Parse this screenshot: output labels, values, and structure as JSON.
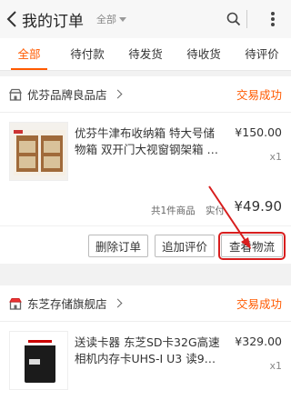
{
  "header": {
    "title": "我的订单",
    "scope": "全部"
  },
  "tabs": [
    "全部",
    "待付款",
    "待发货",
    "待收货",
    "待评价"
  ],
  "orders": [
    {
      "shop": "优芬品牌良品店",
      "status": "交易成功",
      "item": {
        "name": "优芬牛津布收纳箱 特大号储物箱 双开门大视窗钢架箱 …",
        "price": "¥150.00",
        "qty": "x1"
      },
      "summary": {
        "count": "共1件商品",
        "paid_label": "实付",
        "total": "¥49.90"
      },
      "actions": [
        "删除订单",
        "追加评价",
        "查看物流"
      ]
    },
    {
      "shop": "东芝存储旗舰店",
      "status": "交易成功",
      "item": {
        "name": "送读卡器 东芝SD卡32G高速相机内存卡UHS-I U3 读9…",
        "price": "¥329.00",
        "qty": "x1"
      }
    }
  ],
  "colors": {
    "accent": "#ff5a00",
    "highlight": "#d81e1e"
  },
  "icons": {
    "back": "back-chevron-icon",
    "search": "search-icon",
    "more": "more-vertical-icon",
    "shop": "shop-icon"
  }
}
